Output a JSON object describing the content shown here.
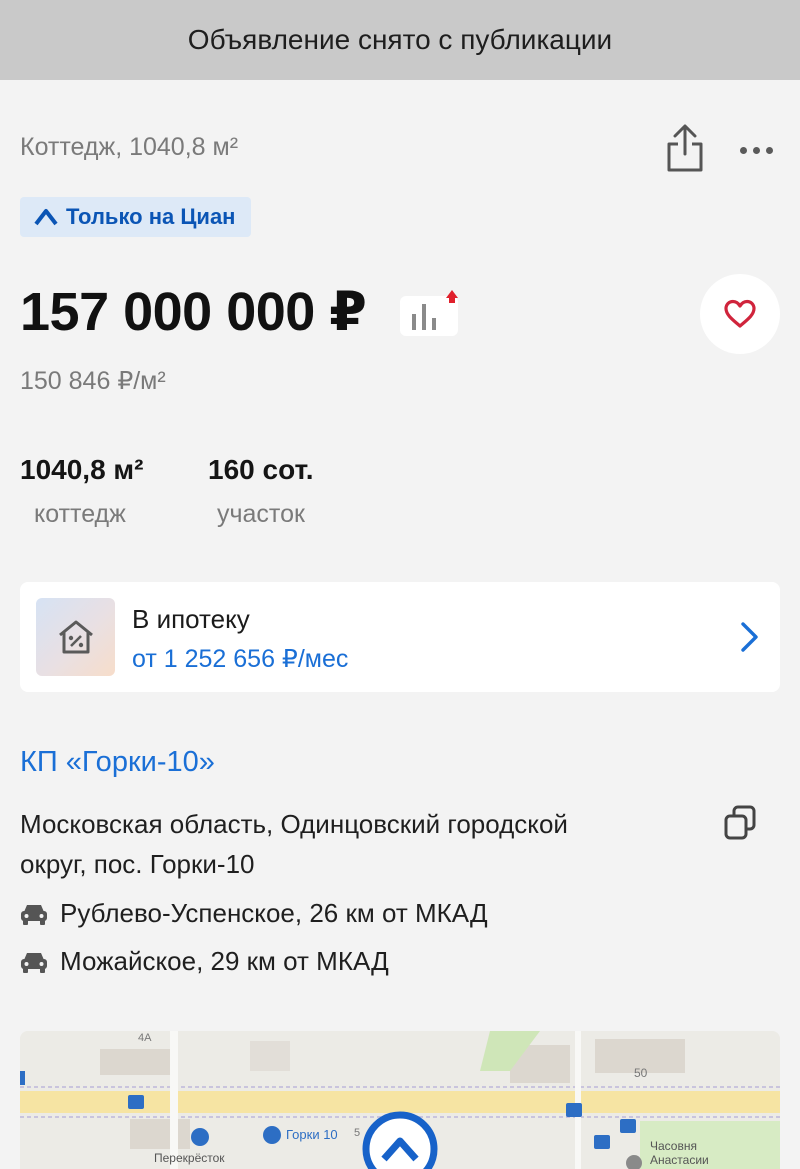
{
  "banner": {
    "text": "Объявление снято с публикации"
  },
  "header": {
    "subtitle": "Коттедж, 1040,8 м²"
  },
  "icons": {
    "share": "share-icon",
    "more": "more-dots-icon",
    "badge": "cian-logo-icon",
    "stats": "price-chart-icon",
    "favorite": "heart-icon",
    "mortgage": "house-percent-icon",
    "chevron": "chevron-right-icon",
    "copy": "copy-icon",
    "car": "car-icon"
  },
  "badge": {
    "label": "Только на Циан"
  },
  "price": {
    "value": "157 000 000 ₽",
    "per_meter": "150 846 ₽/м²"
  },
  "features": [
    {
      "value": "1040,8 м²",
      "label": "коттедж"
    },
    {
      "value": "160 сот.",
      "label": "участок"
    }
  ],
  "mortgage": {
    "title": "В ипотеку",
    "subtitle": "от 1 252 656 ₽/мес"
  },
  "location": {
    "village": "КП «Горки-10»",
    "address_line1": "Московская область, Одинцовский городской",
    "address_line2": "округ, пос. Горки-10",
    "highways": [
      "Рублево-Успенское, 26 км от МКАД",
      "Можайское, 29 км от МКАД"
    ]
  },
  "map": {
    "labels": [
      "4А",
      "50",
      "Горки 10",
      "Перекрёсток",
      "Часовня",
      "Анастасии",
      "5"
    ]
  },
  "colors": {
    "accent": "#1a6fd6",
    "banner_bg": "#c9c9c9",
    "favorite": "#d0243c",
    "price_up": "#e0202c"
  }
}
